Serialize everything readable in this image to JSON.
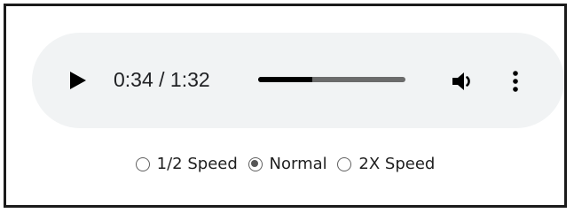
{
  "player": {
    "current_time": "0:34",
    "duration": "1:32",
    "time_display": "0:34 / 1:32",
    "progress_fraction": 0.37,
    "play_icon": "play-icon",
    "volume_icon": "volume-icon",
    "menu_icon": "more-vert-icon"
  },
  "speed": {
    "options": [
      {
        "label": "1/2 Speed",
        "checked": false
      },
      {
        "label": "Normal",
        "checked": true
      },
      {
        "label": "2X Speed",
        "checked": false
      }
    ]
  },
  "colors": {
    "player_background": "#f1f3f4",
    "progress_played": "#000000",
    "progress_remaining": "#6b6b6b",
    "frame_border": "#1b1b1b"
  }
}
